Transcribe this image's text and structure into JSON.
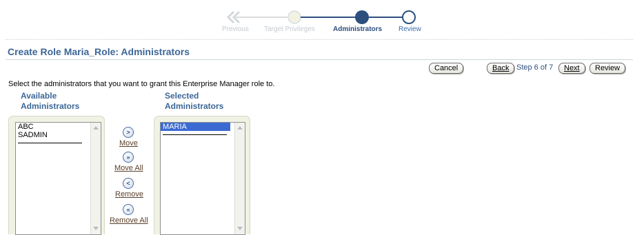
{
  "train": {
    "steps": [
      "Previous",
      "Target Privileges",
      "Administrators",
      "Review"
    ],
    "current": "Administrators"
  },
  "page_title": "Create Role Maria_Role: Administrators",
  "buttons": {
    "cancel": "Cancel",
    "back": "Back",
    "next": "Next",
    "review": "Review"
  },
  "step_info": "Step 6 of 7",
  "instruction": "Select the administrators that you want to grant this Enterprise Manager role to.",
  "available": {
    "header_line1": "Available",
    "header_line2": "Administrators",
    "items": [
      "ABC",
      "SADMIN"
    ]
  },
  "selected": {
    "header_line1": "Selected",
    "header_line2": "Administrators",
    "items": [
      "MARIA"
    ]
  },
  "shuttle": {
    "move": "Move",
    "move_all": "Move All",
    "remove": "Remove",
    "remove_all": "Remove All"
  },
  "colors": {
    "accent": "#3c6697",
    "train_active": "#2c4f7e",
    "train_disabled": "#c4cad0",
    "selection": "#3c6ad3",
    "shuttle_bg": "#f0f2e4"
  }
}
